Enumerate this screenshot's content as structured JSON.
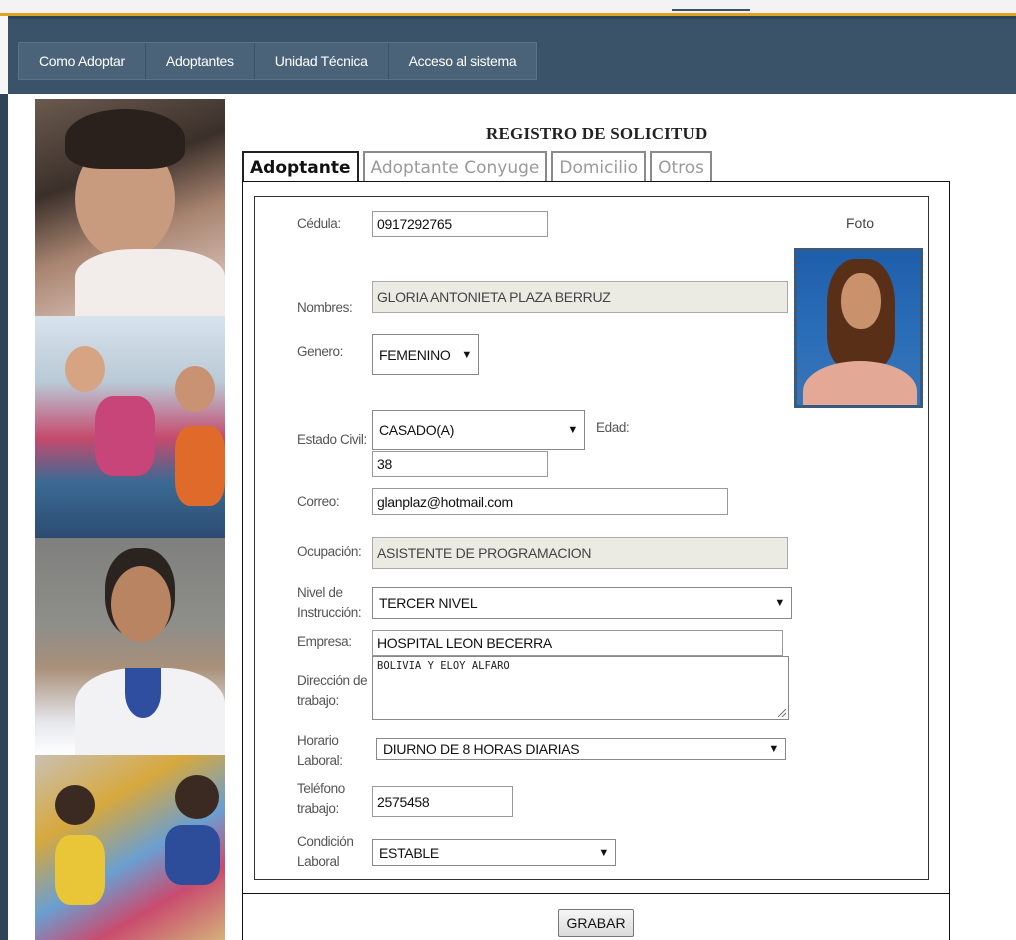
{
  "nav": {
    "items": [
      "Como Adoptar",
      "Adoptantes",
      "Unidad Técnica",
      "Acceso al sistema"
    ]
  },
  "form": {
    "title": "REGISTRO DE SOLICITUD",
    "tabs": [
      "Adoptante",
      "Adoptante Conyuge",
      "Domicilio",
      "Otros"
    ],
    "active_tab": "Adoptante",
    "foto_label": "Foto",
    "fields": {
      "cedula": {
        "label": "Cédula:",
        "value": "0917292765"
      },
      "nombres": {
        "label": "Nombres:",
        "value": "GLORIA ANTONIETA PLAZA BERRUZ"
      },
      "genero": {
        "label": "Genero:",
        "value": "FEMENINO"
      },
      "estado_civil": {
        "label": "Estado Civil:",
        "value": "CASADO(A)"
      },
      "edad": {
        "label": "Edad:",
        "value": "38"
      },
      "correo": {
        "label": "Correo:",
        "value": "glanplaz@hotmail.com"
      },
      "ocupacion": {
        "label": "Ocupación:",
        "value": "ASISTENTE DE PROGRAMACION"
      },
      "nivel_instruccion": {
        "label_1": "Nivel de",
        "label_2": "Instrucción:",
        "value": "TERCER NIVEL"
      },
      "empresa": {
        "label": "Empresa:",
        "value": "HOSPITAL LEON BECERRA"
      },
      "direccion_trabajo": {
        "label_1": "Dirección de",
        "label_2": "trabajo:",
        "value": "BOLIVIA Y ELOY ALFARO"
      },
      "horario_laboral": {
        "label_1": "Horario",
        "label_2": "Laboral:",
        "value": "DIURNO DE 8 HORAS DIARIAS"
      },
      "telefono_trabajo": {
        "label_1": "Teléfono",
        "label_2": "trabajo:",
        "value": "2575458"
      },
      "condicion_laboral": {
        "label_1": "Condición",
        "label_2": "Laboral",
        "value": "ESTABLE"
      }
    },
    "submit_label": "GRABAR"
  },
  "colors": {
    "navbar": "#3a5369",
    "accent_line": "#e0a21f",
    "readonly_field": "#ebebe4"
  }
}
